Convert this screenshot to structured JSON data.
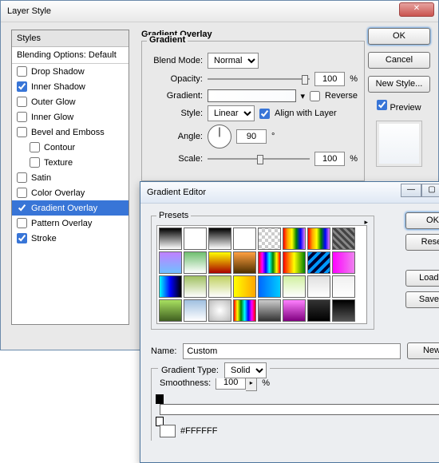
{
  "layerStyle": {
    "title": "Layer Style",
    "stylesHeader": "Styles",
    "blendingOptions": "Blending Options: Default",
    "items": [
      {
        "label": "Drop Shadow",
        "checked": false,
        "indent": false
      },
      {
        "label": "Inner Shadow",
        "checked": true,
        "indent": false
      },
      {
        "label": "Outer Glow",
        "checked": false,
        "indent": false
      },
      {
        "label": "Inner Glow",
        "checked": false,
        "indent": false
      },
      {
        "label": "Bevel and Emboss",
        "checked": false,
        "indent": false
      },
      {
        "label": "Contour",
        "checked": false,
        "indent": true
      },
      {
        "label": "Texture",
        "checked": false,
        "indent": true
      },
      {
        "label": "Satin",
        "checked": false,
        "indent": false
      },
      {
        "label": "Color Overlay",
        "checked": false,
        "indent": false
      },
      {
        "label": "Gradient Overlay",
        "checked": true,
        "indent": false,
        "selected": true
      },
      {
        "label": "Pattern Overlay",
        "checked": false,
        "indent": false
      },
      {
        "label": "Stroke",
        "checked": true,
        "indent": false
      }
    ],
    "gradientOverlay": {
      "groupTitle": "Gradient Overlay",
      "legend": "Gradient",
      "blendModeLabel": "Blend Mode:",
      "blendMode": "Normal",
      "opacityLabel": "Opacity:",
      "opacity": "100",
      "pct": "%",
      "gradientLabel": "Gradient:",
      "reverseLabel": "Reverse",
      "reverse": false,
      "styleLabel": "Style:",
      "style": "Linear",
      "alignLabel": "Align with Layer",
      "align": true,
      "angleLabel": "Angle:",
      "angle": "90",
      "deg": "°",
      "scaleLabel": "Scale:",
      "scale": "100"
    },
    "buttons": {
      "ok": "OK",
      "cancel": "Cancel",
      "newStyle": "New Style...",
      "previewLabel": "Preview",
      "preview": true
    }
  },
  "gradientEditor": {
    "title": "Gradient Editor",
    "presetsLabel": "Presets",
    "swatches": [
      "linear-gradient(#000,#fff)",
      "linear-gradient(#fff,#fff)",
      "linear-gradient(#000,transparent)",
      "linear-gradient(#fff,transparent)",
      "repeating-conic-gradient(#ccc 0 25%,#fff 0 50%) 0/8px 8px,linear-gradient(#4a90d9,#fff)",
      "linear-gradient(to right,red,orange,yellow,green,blue,violet)",
      "linear-gradient(to right,red,orange,yellow,green,blue,violet)",
      "repeating-linear-gradient(45deg,#444 0 3px,#888 3px 6px)",
      "linear-gradient(#c080ff,#70c0ff)",
      "linear-gradient(#6fbf6f,#fff)",
      "linear-gradient(#ff0,#a00)",
      "linear-gradient(#ffa040,#503000)",
      "linear-gradient(to right,red,#ff00ff,blue,cyan,green,yellow,red)",
      "linear-gradient(to right,red,yellow,green)",
      "repeating-linear-gradient(135deg,#09f 0 4px,#003 4px 8px)",
      "linear-gradient(to right,magenta,violet)",
      "linear-gradient(to right,#0ff,#00f,#000)",
      "linear-gradient(#a0c060,#fff)",
      "linear-gradient(#c0d060,#fff)",
      "linear-gradient(to right,yellow,orange)",
      "linear-gradient(to right,#06f,#0cf)",
      "linear-gradient(#d0f0a0,#fff)",
      "linear-gradient(#e0e0e0,#fff)",
      "linear-gradient(#f0f0f0,#fff)",
      "linear-gradient(#a8e060,#406020)",
      "linear-gradient(#a0c0e0,#fff)",
      "radial-gradient(#fff,#bbb)",
      "linear-gradient(to right,red,yellow,green,cyan,blue,magenta,red)",
      "linear-gradient(#ccc,#333)",
      "linear-gradient(#ff80ff,#800080)",
      "linear-gradient(#333,#000)",
      "linear-gradient(#000,#555)"
    ],
    "buttons": {
      "ok": "OK",
      "reset": "Reset",
      "load": "Load...",
      "save": "Save...",
      "new": "New"
    },
    "nameLabel": "Name:",
    "name": "Custom",
    "gradientTypeLabel": "Gradient Type:",
    "gradientType": "Solid",
    "smoothnessLabel": "Smoothness:",
    "smoothness": "100",
    "pct": "%",
    "colorValue": "#FFFFFF"
  }
}
